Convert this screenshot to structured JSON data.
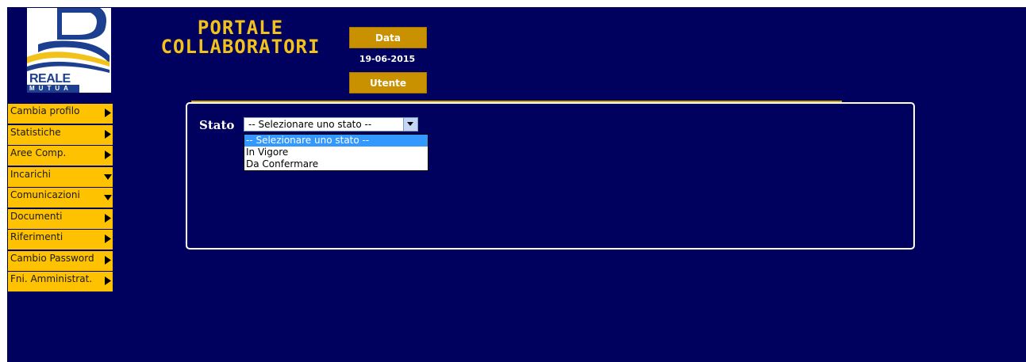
{
  "colors": {
    "page_background": "#00005f",
    "accent_gold": "#ffc200",
    "title_yellow": "#f2c21b",
    "header_box": "#c99100",
    "selected_option": "#3399ff"
  },
  "logo": {
    "word": "REALE",
    "subword": "MUTUA"
  },
  "header": {
    "title": "PORTALE\nCOLLABORATORI",
    "date_label": "Data",
    "date_value": "19-06-2015",
    "user_label": "Utente"
  },
  "sidebar": {
    "items": [
      {
        "label": "Cambia profilo",
        "icon": "arrow-right-icon"
      },
      {
        "label": "Statistiche",
        "icon": "arrow-right-icon"
      },
      {
        "label": "Aree Comp.",
        "icon": "arrow-right-icon"
      },
      {
        "label": "Incarichi",
        "icon": "arrow-down-icon"
      },
      {
        "label": "Comunicazioni",
        "icon": "arrow-down-icon"
      },
      {
        "label": "Documenti",
        "icon": "arrow-right-icon"
      },
      {
        "label": "Riferimenti",
        "icon": "arrow-right-icon"
      },
      {
        "label": "Cambio Password",
        "icon": "arrow-right-icon"
      },
      {
        "label": "Fni. Amministrat.",
        "icon": "arrow-right-icon"
      }
    ]
  },
  "form": {
    "stato_label": "Stato",
    "select_value": "-- Selezionare uno stato --",
    "options": [
      "-- Selezionare uno stato --",
      "In Vigore",
      "Da Confermare"
    ],
    "selected_index": 0
  }
}
